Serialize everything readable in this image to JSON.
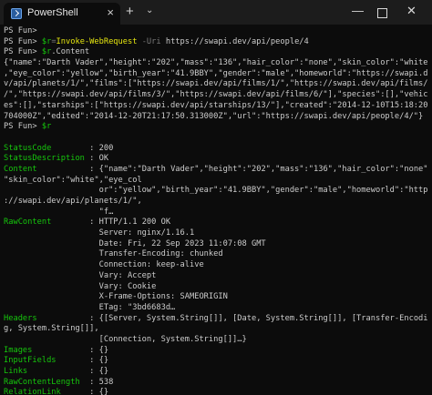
{
  "window": {
    "tab_title": "PowerShell",
    "tab_close": "×",
    "new_tab": "+",
    "dropdown": "⌄",
    "minimize": "—",
    "close": "✕"
  },
  "terminal": {
    "lines": [
      [
        {
          "t": "PS Fun>",
          "c": "w"
        }
      ],
      [
        {
          "t": "PS Fun> ",
          "c": "w"
        },
        {
          "t": "$r",
          "c": "g"
        },
        {
          "t": "=",
          "c": "d"
        },
        {
          "t": "Invoke-WebRequest ",
          "c": "y"
        },
        {
          "t": "-Uri ",
          "c": "d"
        },
        {
          "t": "https://swapi.dev/api/people/4",
          "c": "w"
        }
      ],
      [
        {
          "t": "PS Fun> ",
          "c": "w"
        },
        {
          "t": "$r",
          "c": "g"
        },
        {
          "t": ".Content",
          "c": "w"
        }
      ],
      [
        {
          "t": "{\"name\":\"Darth Vader\",\"height\":\"202\",\"mass\":\"136\",\"hair_color\":\"none\",\"skin_color\":\"white\"",
          "c": "w"
        }
      ],
      [
        {
          "t": ",\"eye_color\":\"yellow\",\"birth_year\":\"41.9BBY\",\"gender\":\"male\",\"homeworld\":\"https://swapi.de",
          "c": "w"
        }
      ],
      [
        {
          "t": "v/api/planets/1/\",\"films\":[\"https://swapi.dev/api/films/1/\",\"https://swapi.dev/api/films/2",
          "c": "w"
        }
      ],
      [
        {
          "t": "/\",\"https://swapi.dev/api/films/3/\",\"https://swapi.dev/api/films/6/\"],\"species\":[],\"vehicl",
          "c": "w"
        }
      ],
      [
        {
          "t": "es\":[],\"starships\":[\"https://swapi.dev/api/starships/13/\"],\"created\":\"2014-12-10T15:18:20.",
          "c": "w"
        }
      ],
      [
        {
          "t": "704000Z\",\"edited\":\"2014-12-20T21:17:50.313000Z\",\"url\":\"https://swapi.dev/api/people/4/\"}",
          "c": "w"
        }
      ],
      [
        {
          "t": "PS Fun> ",
          "c": "w"
        },
        {
          "t": "$r",
          "c": "g"
        }
      ],
      [
        {
          "t": "",
          "c": "w"
        }
      ],
      [
        {
          "t": "StatusCode        ",
          "c": "g"
        },
        {
          "t": ": 200",
          "c": "w"
        }
      ],
      [
        {
          "t": "StatusDescription ",
          "c": "g"
        },
        {
          "t": ": OK",
          "c": "w"
        }
      ],
      [
        {
          "t": "Content           ",
          "c": "g"
        },
        {
          "t": ": {\"name\":\"Darth Vader\",\"height\":\"202\",\"mass\":\"136\",\"hair_color\":\"none\",",
          "c": "w"
        }
      ],
      [
        {
          "t": "\"skin_color\":\"white\",\"eye_col",
          "c": "w"
        }
      ],
      [
        {
          "t": "                    or\":\"yellow\",\"birth_year\":\"41.9BBY\",\"gender\":\"male\",\"homeworld\":\"https",
          "c": "w"
        }
      ],
      [
        {
          "t": "://swapi.dev/api/planets/1/\",",
          "c": "w"
        }
      ],
      [
        {
          "t": "                    \"f…",
          "c": "w"
        }
      ],
      [
        {
          "t": "RawContent        ",
          "c": "g"
        },
        {
          "t": ": HTTP/1.1 200 OK",
          "c": "w"
        }
      ],
      [
        {
          "t": "                    Server: nginx/1.16.1",
          "c": "w"
        }
      ],
      [
        {
          "t": "                    Date: Fri, 22 Sep 2023 11:07:08 GMT",
          "c": "w"
        }
      ],
      [
        {
          "t": "                    Transfer-Encoding: chunked",
          "c": "w"
        }
      ],
      [
        {
          "t": "                    Connection: keep-alive",
          "c": "w"
        }
      ],
      [
        {
          "t": "                    Vary: Accept",
          "c": "w"
        }
      ],
      [
        {
          "t": "                    Vary: Cookie",
          "c": "w"
        }
      ],
      [
        {
          "t": "                    X-Frame-Options: SAMEORIGIN",
          "c": "w"
        }
      ],
      [
        {
          "t": "                    ETag: \"3bd6683d…",
          "c": "w"
        }
      ],
      [
        {
          "t": "Headers           ",
          "c": "g"
        },
        {
          "t": ": {[Server, System.String[]], [Date, System.String[]], [Transfer-Encodin",
          "c": "w"
        }
      ],
      [
        {
          "t": "g, System.String[]],",
          "c": "w"
        }
      ],
      [
        {
          "t": "                    [Connection, System.String[]]…}",
          "c": "w"
        }
      ],
      [
        {
          "t": "Images            ",
          "c": "g"
        },
        {
          "t": ": {}",
          "c": "w"
        }
      ],
      [
        {
          "t": "InputFields       ",
          "c": "g"
        },
        {
          "t": ": {}",
          "c": "w"
        }
      ],
      [
        {
          "t": "Links             ",
          "c": "g"
        },
        {
          "t": ": {}",
          "c": "w"
        }
      ],
      [
        {
          "t": "RawContentLength  ",
          "c": "g"
        },
        {
          "t": ": 538",
          "c": "w"
        }
      ],
      [
        {
          "t": "RelationLink      ",
          "c": "g"
        },
        {
          "t": ": {}",
          "c": "w"
        }
      ]
    ]
  }
}
